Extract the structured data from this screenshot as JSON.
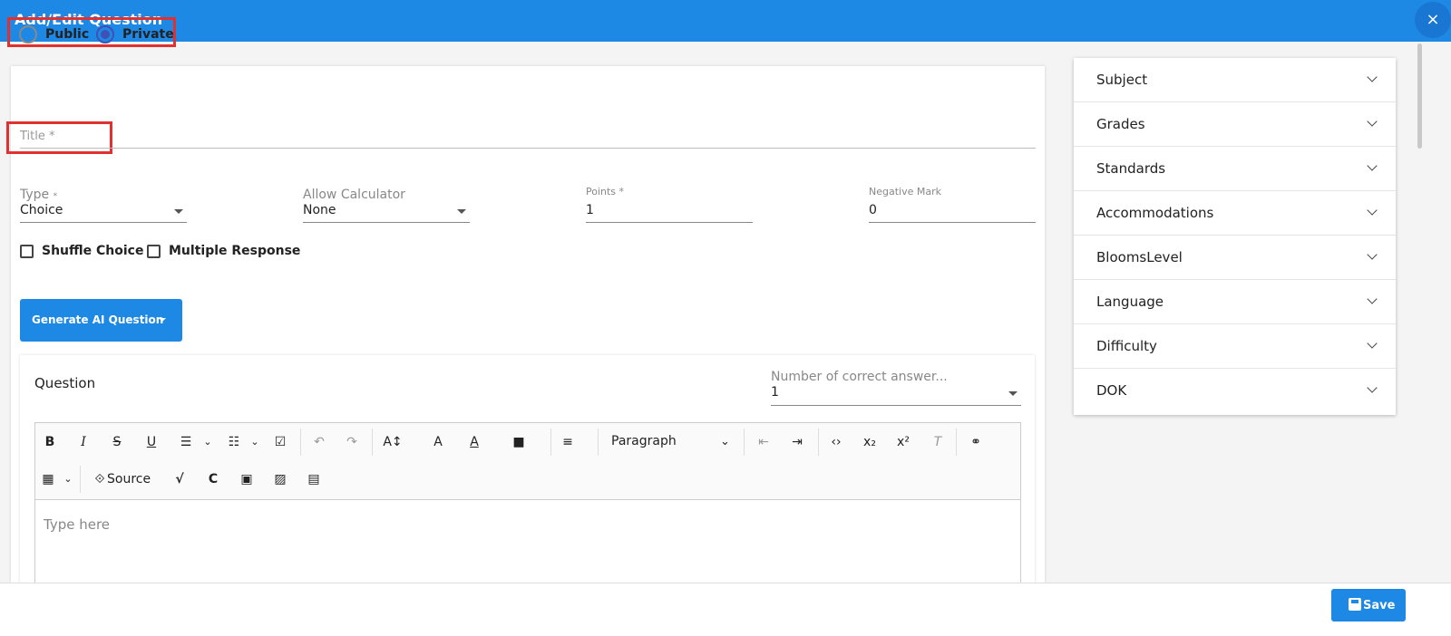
{
  "header": {
    "title": "Add/Edit Question",
    "close_icon": "×"
  },
  "visibility": {
    "public_label": "Public",
    "private_label": "Private",
    "selected": "Private"
  },
  "title_field": {
    "placeholder": "Title *"
  },
  "type_field": {
    "label": "Type",
    "required_mark": "*",
    "value": "Choice"
  },
  "calculator_field": {
    "label": "Allow Calculator",
    "value": "None"
  },
  "points_field": {
    "label": "Points *",
    "value": "1"
  },
  "negative_field": {
    "label": "Negative Mark",
    "value": "0"
  },
  "options": {
    "shuffle_label": "Shuffle Choice",
    "multiple_label": "Multiple Response"
  },
  "generate_button": {
    "label": "Generate AI Question"
  },
  "question": {
    "label": "Question",
    "correct_answers_label": "Number of correct answer...",
    "correct_answers_value": "1",
    "editor_placeholder": "Type here"
  },
  "toolbar": {
    "bold": "B",
    "italic": "I",
    "strike": "S",
    "underline": "U",
    "paragraph_value": "Paragraph",
    "source_label": "Source"
  },
  "sidebar": {
    "items": [
      {
        "label": "Subject"
      },
      {
        "label": "Grades"
      },
      {
        "label": "Standards"
      },
      {
        "label": "Accommodations"
      },
      {
        "label": "BloomsLevel"
      },
      {
        "label": "Language"
      },
      {
        "label": "Difficulty"
      },
      {
        "label": "DOK"
      }
    ]
  },
  "footer": {
    "save_label": "Save"
  },
  "colors": {
    "primary": "#1e88e5",
    "highlight": "#e03030",
    "radio_selected": "#3f51b5"
  }
}
